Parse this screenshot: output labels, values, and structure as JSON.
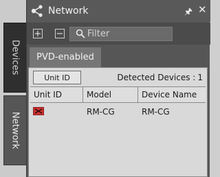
{
  "side_tabs": {
    "devices": "Devices",
    "network": "Network"
  },
  "panel": {
    "title": "Network"
  },
  "toolbar": {
    "add_icon": "plus-icon",
    "remove_icon": "minus-icon",
    "search_placeholder": "Filter"
  },
  "tabs": {
    "active": "PVD-enabled"
  },
  "unit_id_button": "Unit ID",
  "detected": {
    "label": "Detected Devices :",
    "count": "1"
  },
  "table": {
    "headers": [
      "Unit ID",
      "Model",
      "Device Name"
    ],
    "rows": [
      {
        "icon": "device-error-icon",
        "model": "RM-CG",
        "device_name": "RM-CG"
      }
    ]
  },
  "colors": {
    "device_icon": "#cc3333",
    "panel_bg": "#565656",
    "content_bg": "#d9d9d9"
  }
}
